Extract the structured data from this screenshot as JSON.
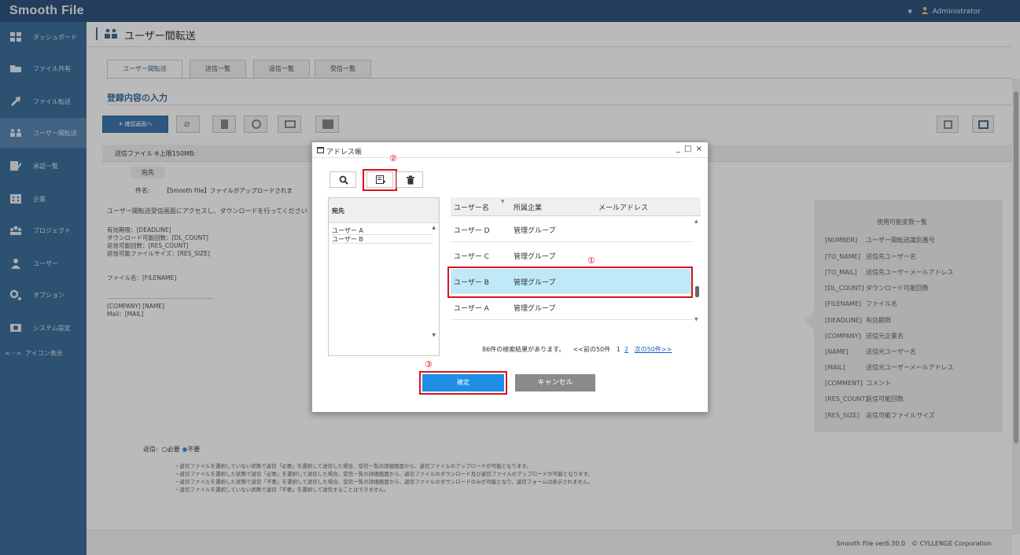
{
  "app": {
    "logo": "Smooth File",
    "user": "Administrator"
  },
  "sidebar": {
    "items": [
      {
        "label": "ダッシュボード"
      },
      {
        "label": "ファイル共有"
      },
      {
        "label": "ファイル転送"
      },
      {
        "label": "ユーザー間転送"
      },
      {
        "label": "承認一覧"
      },
      {
        "label": "企業"
      },
      {
        "label": "プロジェクト"
      },
      {
        "label": "ユーザー"
      },
      {
        "label": "オプション"
      },
      {
        "label": "システム設定"
      }
    ],
    "toggle_label": "アイコン表示"
  },
  "page": {
    "title": "ユーザー間転送"
  },
  "tabs": [
    "ユーザー間転送",
    "送信一覧",
    "返信一覧",
    "受信一覧"
  ],
  "section": {
    "title": "登録内容の入力"
  },
  "toolbar": {
    "confirm_label": "確認画面へ"
  },
  "form": {
    "send_file_label": "送信ファイル",
    "send_file_limit": "※上限150MB:",
    "to_label": "宛先",
    "subject_label": "件名:",
    "subject_value": "【Smooth File】ファイルがアップロードされま",
    "body_lines": [
      "ユーザー間転送受信画面にアクセスし、ダウンロードを行ってください",
      "",
      "有効期限：[DEADLINE]",
      "ダウンロード可能回数：[DL_COUNT]",
      "返信可能回数：[RES_COUNT]",
      "返信可能ファイルサイズ：[RES_SIZE]",
      "",
      "ファイル名：[FILENAME]",
      "",
      "",
      "--------------------------------------------------",
      "[COMPANY] [NAME]",
      "Mail：[MAIL]"
    ]
  },
  "variables": {
    "title": "使用可能変数一覧",
    "rows": [
      {
        "key": "[NUMBER]",
        "desc": "ユーザー間転送識別番号"
      },
      {
        "key": "[TO_NAME]",
        "desc": "送信先ユーザー名"
      },
      {
        "key": "[TO_MAIL]",
        "desc": "送信先ユーザーメールアドレス"
      },
      {
        "key": "[DL_COUNT]",
        "desc": "ダウンロード可能回数"
      },
      {
        "key": "[FILENAME]",
        "desc": "ファイル名"
      },
      {
        "key": "[DEADLINE]",
        "desc": "有効期限"
      },
      {
        "key": "[COMPANY]",
        "desc": "送信元企業名"
      },
      {
        "key": "[NAME]",
        "desc": "送信元ユーザー名"
      },
      {
        "key": "[MAIL]",
        "desc": "送信元ユーザーメールアドレス"
      },
      {
        "key": "[COMMENT]",
        "desc": "コメント"
      },
      {
        "key": "[RES_COUNT]",
        "desc": "返信可能回数"
      },
      {
        "key": "[RES_SIZE]",
        "desc": "返信可能ファイルサイズ"
      }
    ]
  },
  "reply": {
    "label": "返信:",
    "opt_required": "必要",
    "opt_not_required": "不要"
  },
  "notes": [
    "・返信ファイルを選択していない状態で返信「必要」を選択して送信した場合、受信一覧の詳細画面から、返信ファイルのアップロードが可能となります。",
    "・返信ファイルを選択した状態で返信「必要」を選択して送信した場合、受信一覧の詳細画面から、返信ファイルのダウンロード及び返信ファイルのアップロードが可能となります。",
    "・返信ファイルを選択した状態で返信「不要」を選択して送信した場合、受信一覧の詳細画面から、返信ファイルのダウンロードのみが可能となり、返信フォームは表示されません。",
    "・返信ファイルを選択していない状態で返信「不要」を選択して送信することはできません。"
  ],
  "footer": {
    "text": "Smooth File ver6.30.0　© CYLLENGE Corporation"
  },
  "dialog": {
    "title": "アドレス帳",
    "controls": "_ □ ×",
    "recipients_header": "宛先",
    "recipients": [
      "ユーザー A",
      "ユーザー B"
    ],
    "columns": {
      "user_name": "ユーザー名",
      "company": "所属企業",
      "email": "メールアドレス"
    },
    "rows": [
      {
        "name": "ユーザー D",
        "company": "管理グループ",
        "email": "",
        "selected": false
      },
      {
        "name": "ユーザー C",
        "company": "管理グループ",
        "email": "",
        "selected": false
      },
      {
        "name": "ユーザー B",
        "company": "管理グループ",
        "email": "",
        "selected": true
      },
      {
        "name": "ユーザー A",
        "company": "管理グループ",
        "email": "",
        "selected": false
      }
    ],
    "pager": {
      "summary": "86件の検索結果があります。",
      "prev": "<<前の50件",
      "page1": "1",
      "page2": "2",
      "next": "次の50件>>"
    },
    "ok_label": "確定",
    "cancel_label": "キャンセル",
    "callouts": {
      "one": "①",
      "two": "②",
      "three": "③"
    }
  },
  "colors": {
    "header": "#31557f",
    "sidebar": "#3d6f9c",
    "highlight": "#d5151d",
    "selected_row": "#bfe9f7",
    "primary": "#1e8ee6"
  }
}
